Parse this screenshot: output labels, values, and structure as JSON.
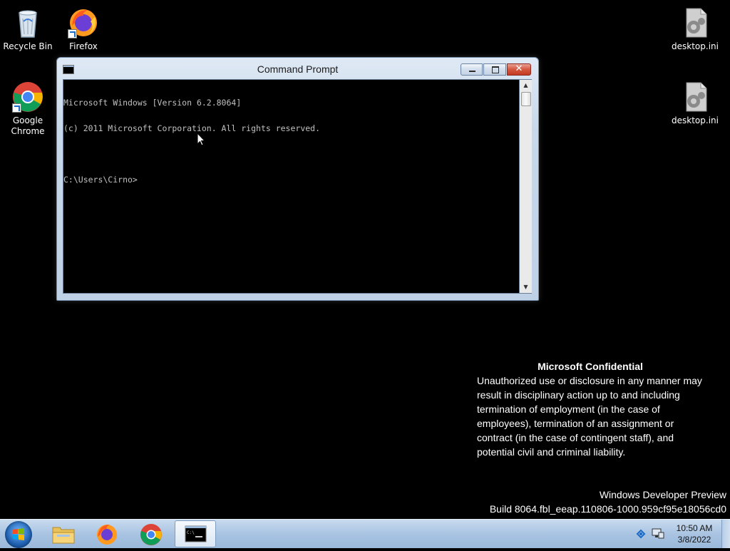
{
  "desktop": {
    "icons": [
      {
        "label": "Recycle Bin",
        "icon": "recycle-bin-icon"
      },
      {
        "label": "Firefox",
        "icon": "firefox-icon"
      },
      {
        "label": "Google Chrome",
        "icon": "chrome-icon"
      },
      {
        "label": "desktop.ini",
        "icon": "settings-file-icon"
      },
      {
        "label": "desktop.ini",
        "icon": "settings-file-icon"
      }
    ]
  },
  "window": {
    "title": "Command Prompt",
    "console_lines": [
      "Microsoft Windows [Version 6.2.8064]",
      "(c) 2011 Microsoft Corporation. All rights reserved.",
      "",
      "C:\\Users\\Cirno>"
    ],
    "close_label": "✕"
  },
  "watermark": {
    "heading": "Microsoft Confidential",
    "lines": [
      "Unauthorized use or disclosure in any manner may",
      "result in disciplinary action up to and including",
      "termination of employment (in the case of",
      "employees), termination of an assignment or",
      "contract (in the case of contingent staff), and",
      "potential civil and criminal liability."
    ],
    "build_title": "Windows Developer Preview",
    "build_number": "Build 8064.fbl_eeap.110806-1000.959cf95e18056cd0"
  },
  "taskbar": {
    "pinned": [
      {
        "name": "file-explorer",
        "icon": "folder-icon"
      },
      {
        "name": "firefox",
        "icon": "firefox-icon"
      },
      {
        "name": "chrome",
        "icon": "chrome-icon"
      },
      {
        "name": "command-prompt",
        "icon": "cmd-icon",
        "active": true
      }
    ],
    "clock": {
      "time": "10:50 AM",
      "date": "3/8/2022"
    }
  }
}
